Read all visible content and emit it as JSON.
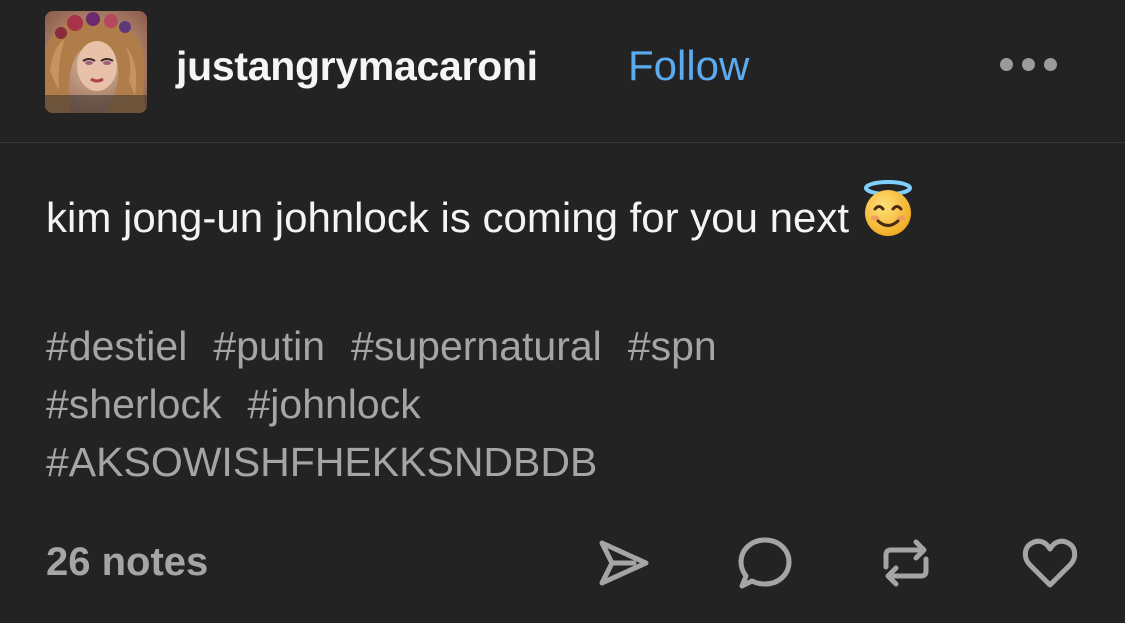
{
  "post": {
    "author": {
      "username": "justangrymacaroni",
      "follow_label": "Follow",
      "avatar_icon": "profile-photo"
    },
    "more_icon": "ellipsis-icon",
    "body_text": "kim jong-un johnlock is coming for you next",
    "body_emoji": "smiling-face-with-halo",
    "tags": [
      "#destiel",
      "#putin",
      "#supernatural",
      "#spn",
      "#sherlock",
      "#johnlock",
      "#AKSOWISHFHEKKSNDBDB"
    ],
    "notes_label": "26 notes",
    "actions": [
      {
        "name": "share",
        "icon": "send-icon"
      },
      {
        "name": "reply",
        "icon": "chat-bubble-icon"
      },
      {
        "name": "reblog",
        "icon": "reblog-icon"
      },
      {
        "name": "like",
        "icon": "heart-icon"
      }
    ]
  },
  "colors": {
    "background": "#232323",
    "follow": "#5aabf0",
    "muted_text": "#a5a5a5",
    "icon": "#a5a5a5"
  }
}
